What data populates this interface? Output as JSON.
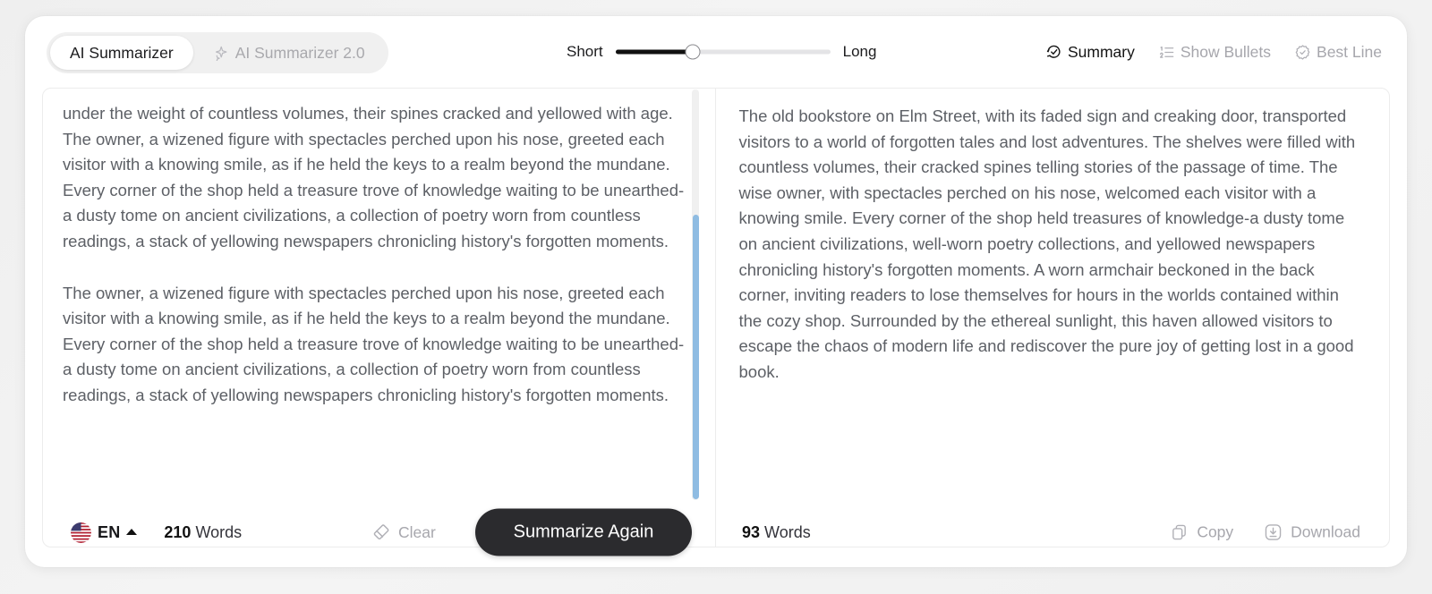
{
  "tabs": [
    {
      "label": "AI Summarizer",
      "active": true,
      "icon": ""
    },
    {
      "label": "AI Summarizer 2.0",
      "active": false,
      "icon": "sparkle-icon"
    }
  ],
  "slider": {
    "min_label": "Short",
    "max_label": "Long",
    "value_percent": 36
  },
  "modes": [
    {
      "label": "Summary",
      "icon": "history-check-icon",
      "active": true
    },
    {
      "label": "Show Bullets",
      "icon": "numbered-list-icon",
      "active": false
    },
    {
      "label": "Best Line",
      "icon": "badge-check-icon",
      "active": false
    }
  ],
  "input_panel": {
    "paragraphs": [
      "under the weight of countless volumes, their spines cracked and yellowed with age.\nThe owner, a wizened figure with spectacles perched upon his nose, greeted each visitor with a knowing smile, as if he held the keys to a realm beyond the mundane. Every corner of the shop held a treasure trove of knowledge waiting to be unearthed-a dusty tome on ancient civilizations, a collection of poetry worn from countless readings, a stack of yellowing newspapers chronicling history's forgotten moments.",
      "The owner, a wizened figure with spectacles perched upon his nose, greeted each visitor with a knowing smile, as if he held the keys to a realm beyond the mundane. Every corner of the shop held a treasure trove of knowledge waiting to be unearthed-a dusty tome on ancient civilizations, a collection of poetry worn from countless readings, a stack of yellowing newspapers chronicling history's forgotten moments."
    ],
    "word_count": "210",
    "word_count_label": "Words",
    "language_code": "EN",
    "language_icon": "us-flag-icon",
    "clear_label": "Clear",
    "summarize_label": "Summarize Again"
  },
  "output_panel": {
    "text": "The old bookstore on Elm Street, with its faded sign and creaking door, transported visitors to a world of forgotten tales and lost adventures. The shelves were filled with countless volumes, their cracked spines telling stories of the passage of time. The wise owner, with spectacles perched on his nose, welcomed each visitor with a knowing smile. Every corner of the shop held treasures of knowledge-a dusty tome on ancient civilizations, well-worn poetry collections, and yellowed newspapers chronicling history's forgotten moments. A worn armchair beckoned in the back corner, inviting readers to lose themselves for hours in the worlds contained within the cozy shop. Surrounded by the ethereal sunlight, this haven allowed visitors to escape the chaos of modern life and rediscover the pure joy of getting lost in a good book.",
    "word_count": "93",
    "word_count_label": "Words",
    "copy_label": "Copy",
    "download_label": "Download"
  },
  "colors": {
    "accent_dark": "#2b2b2e",
    "scrollbar": "#8fbce2",
    "muted_text": "#a7a7ad",
    "body_text": "#5d6066"
  }
}
